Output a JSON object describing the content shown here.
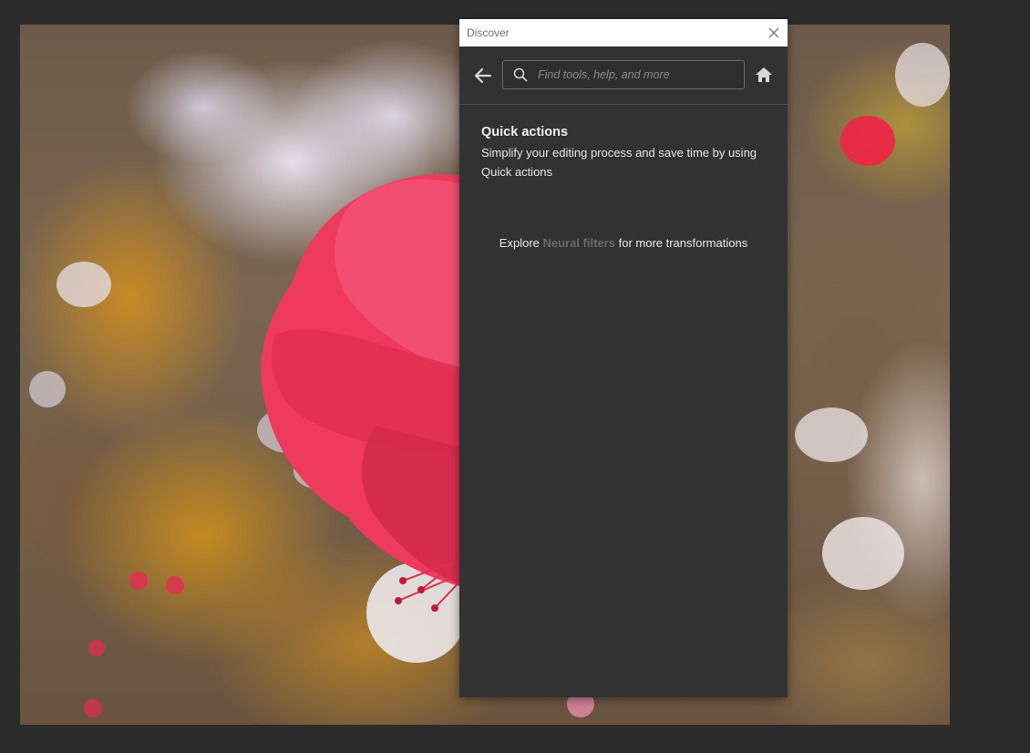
{
  "panel": {
    "title": "Discover",
    "search": {
      "placeholder": "Find tools, help, and more",
      "value": ""
    },
    "icons": {
      "close": "close-icon",
      "back": "arrow-left-icon",
      "search": "search-icon",
      "home": "home-icon"
    },
    "section": {
      "title": "Quick actions",
      "description": "Simplify your editing process and save time by using Quick actions"
    },
    "explore": {
      "prefix": "Explore ",
      "link_text": "Neural filters",
      "suffix": " for more transformations"
    }
  },
  "colors": {
    "workspace_bg": "#2c2c2c",
    "panel_bg": "#323232",
    "titlebar_bg": "#ffffff",
    "link_muted": "#6a6a6a",
    "flower": "#f0385a"
  }
}
